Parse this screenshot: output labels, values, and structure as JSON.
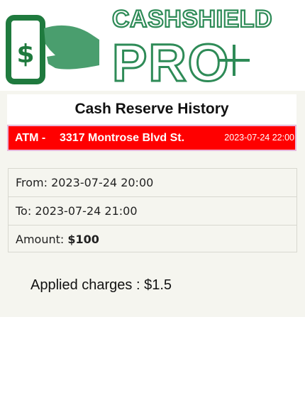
{
  "brand": {
    "name": "CASHSHIELD",
    "tagline": "PRO",
    "colors": {
      "green": "#2e8b57",
      "dark_green": "#1f7a3e",
      "hand": "#4a9e6e"
    }
  },
  "page": {
    "title": "Cash Reserve History"
  },
  "transaction": {
    "atm_label": "ATM - ",
    "address": "3317 Montrose Blvd St.",
    "datetime": "2023-07-24 22:00",
    "from_label": "From:",
    "from_value": "2023-07-24 20:00",
    "to_label": "To:",
    "to_value": "2023-07-24 21:00",
    "amount_label": "Amount:",
    "amount_value": "$100",
    "charges_text": "Applied charges : $1.5"
  },
  "colors": {
    "alert_red": "#ff0000",
    "panel_bg": "#f5f5ef"
  }
}
